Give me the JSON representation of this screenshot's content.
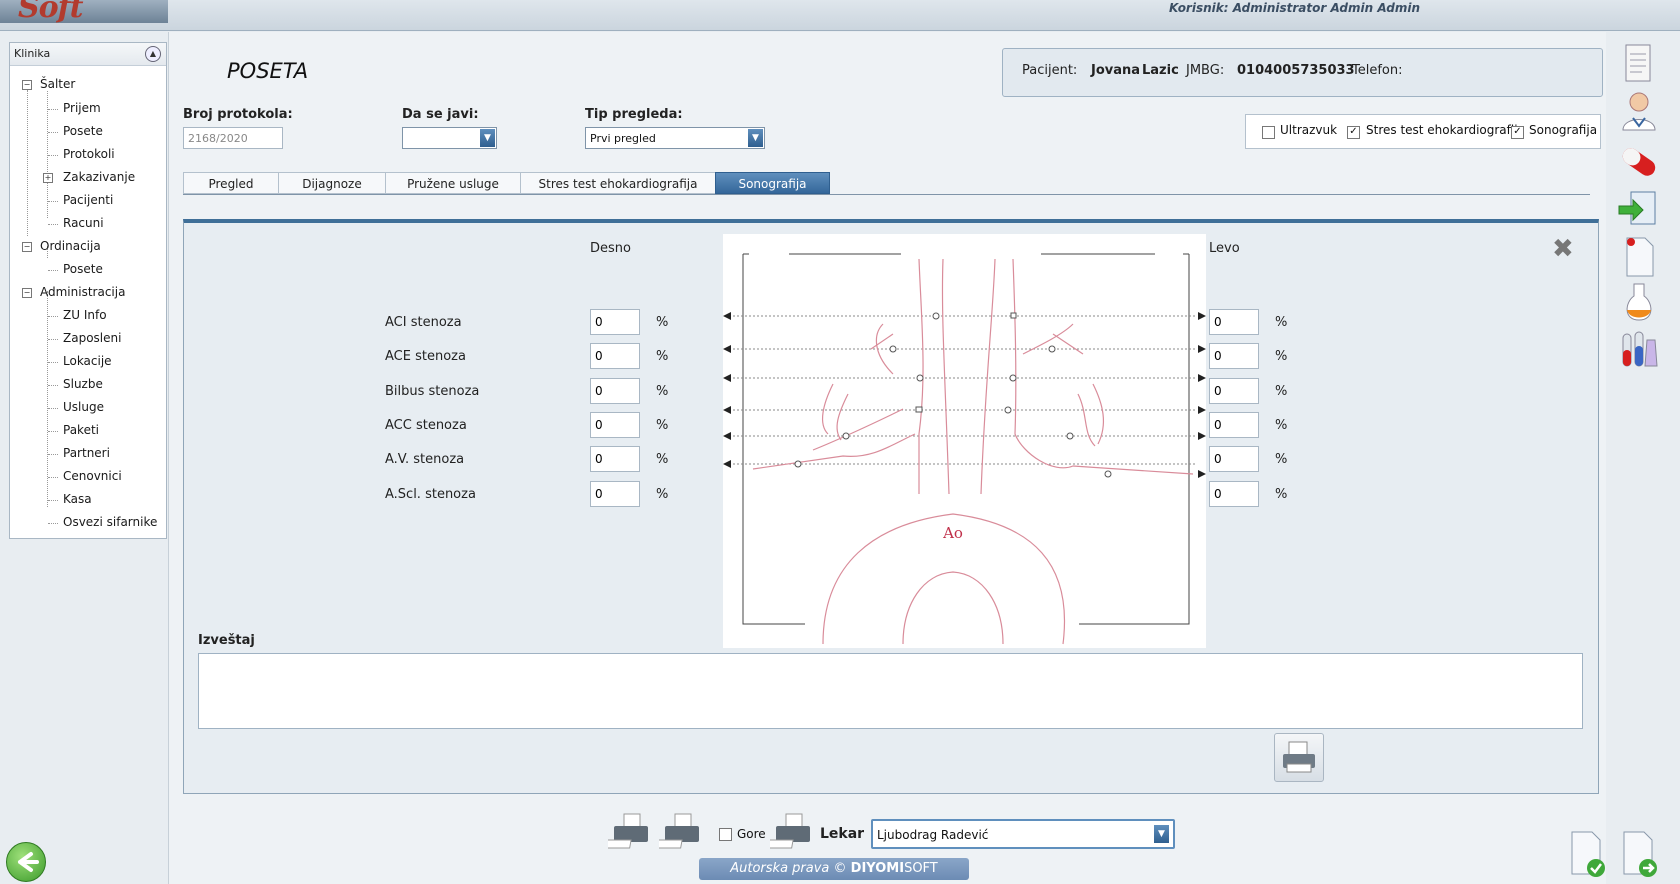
{
  "header": {
    "user_label": "Korisnik: Administrator Admin Admin"
  },
  "sidebar": {
    "title": "Klinika",
    "groups": [
      {
        "label": "Šalter",
        "items": [
          "Prijem",
          "Posete",
          "Protokoli",
          "Zakazivanje",
          "Pacijenti",
          "Racuni"
        ]
      },
      {
        "label": "Ordinacija",
        "items": [
          "Posete"
        ]
      },
      {
        "label": "Administracija",
        "items": [
          "ZU Info",
          "Zaposleni",
          "Lokacije",
          "Sluzbe",
          "Usluge",
          "Paketi",
          "Partneri",
          "Cenovnici",
          "Kasa",
          "Osvezi sifarnike"
        ]
      }
    ]
  },
  "page": {
    "title": "POSETA"
  },
  "patient": {
    "pacijent_label": "Pacijent:",
    "first_name": "Jovana",
    "last_name": "Lazic",
    "jmbg_label": "JMBG:",
    "jmbg": "0104005735033",
    "telefon_label": "Telefon:"
  },
  "form": {
    "protocol_label": "Broj protokola:",
    "protocol_value": "2168/2020",
    "dasejavi_label": "Da se javi:",
    "dasejavi_value": "",
    "tip_label": "Tip pregleda:",
    "tip_value": "Prvi pregled"
  },
  "checks": [
    {
      "label": "Ultrazvuk",
      "checked": false
    },
    {
      "label": "Stres test ehokardiografija",
      "checked": true
    },
    {
      "label": "Sonografija",
      "checked": true
    }
  ],
  "tabs": [
    "Pregled",
    "Dijagnoze",
    "Pružene usluge",
    "Stres test ehokardiografija",
    "Sonografija"
  ],
  "active_tab": "Sonografija",
  "sono": {
    "desno_label": "Desno",
    "levo_label": "Levo",
    "pct": "%",
    "rows": [
      {
        "label": "ACI stenoza",
        "desno": "0",
        "levo": "0"
      },
      {
        "label": "ACE stenoza",
        "desno": "0",
        "levo": "0"
      },
      {
        "label": "Bilbus stenoza",
        "desno": "0",
        "levo": "0"
      },
      {
        "label": "ACC stenoza",
        "desno": "0",
        "levo": "0"
      },
      {
        "label": "A.V. stenoza",
        "desno": "0",
        "levo": "0"
      },
      {
        "label": "A.Scl. stenoza",
        "desno": "0",
        "levo": "0"
      }
    ],
    "diagram_label": "Ao",
    "report_label": "Izveštaj",
    "report_value": ""
  },
  "footer": {
    "gore_label": "Gore",
    "lekar_label": "Lekar",
    "lekar_value": "Ljubodrag Radević",
    "copyright_prefix": "Autorska prava © ",
    "copyright_brand": "DIYOMI",
    "copyright_suffix": "SOFT"
  },
  "icons": [
    "back-arrow-icon",
    "document-icon",
    "doctor-icon",
    "pill-icon",
    "import-icon",
    "new-document-icon",
    "flask-icon",
    "test-tubes-icon",
    "approve-document-icon",
    "next-document-icon",
    "printer-icon",
    "close-icon"
  ]
}
